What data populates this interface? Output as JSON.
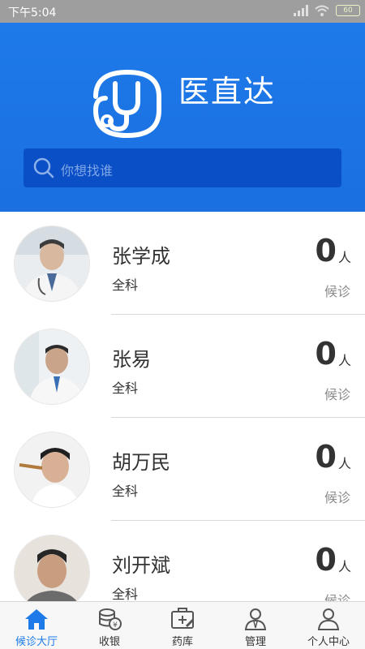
{
  "status_bar": {
    "time": "下午5:04",
    "battery": "60"
  },
  "app": {
    "title": "医直达"
  },
  "search": {
    "placeholder": "你想找谁"
  },
  "doctors": [
    {
      "name": "张学成",
      "department": "全科",
      "count": "0",
      "unit": "人",
      "status": "候诊"
    },
    {
      "name": "张易",
      "department": "全科",
      "count": "0",
      "unit": "人",
      "status": "候诊"
    },
    {
      "name": "胡万民",
      "department": "全科",
      "count": "0",
      "unit": "人",
      "status": "候诊"
    },
    {
      "name": "刘开斌",
      "department": "全科",
      "count": "0",
      "unit": "人",
      "status": "候诊"
    }
  ],
  "tabs": [
    {
      "label": "候诊大厅",
      "icon": "home-icon",
      "active": true
    },
    {
      "label": "收银",
      "icon": "cash-icon",
      "active": false
    },
    {
      "label": "药库",
      "icon": "medicine-kit-icon",
      "active": false
    },
    {
      "label": "管理",
      "icon": "manager-icon",
      "active": false
    },
    {
      "label": "个人中心",
      "icon": "user-icon",
      "active": false
    }
  ],
  "colors": {
    "brand_blue": "#1e7ae9",
    "search_bg": "#0b4fc6",
    "status_bar": "#9e9e9e"
  }
}
